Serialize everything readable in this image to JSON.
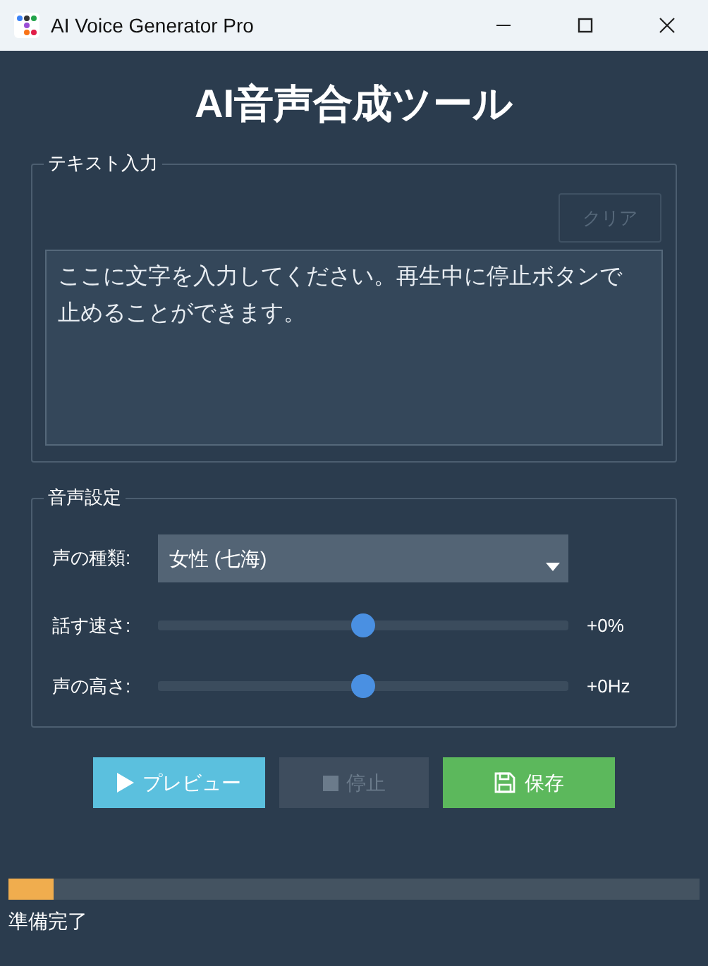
{
  "window": {
    "title": "AI Voice Generator Pro"
  },
  "heading": "AI音声合成ツール",
  "text_input": {
    "legend": "テキスト入力",
    "clear_button": {
      "label": "クリア",
      "disabled": true
    },
    "value": "ここに文字を入力してください。再生中に停止ボタンで止めることができます。"
  },
  "voice_settings": {
    "legend": "音声設定",
    "voice": {
      "label": "声の種類:",
      "value": "女性 (七海)"
    },
    "sliders": [
      {
        "label": "話す速さ:",
        "level": 0.5,
        "reading": "+0%"
      },
      {
        "label": "声の高さ:",
        "level": 0.5,
        "reading": "+0Hz"
      }
    ]
  },
  "buttons": [
    {
      "kind": "play",
      "label": "プレビュー",
      "disabled": false
    },
    {
      "kind": "stop",
      "label": "停止",
      "disabled": true
    },
    {
      "kind": "save",
      "label": "保存",
      "disabled": false
    }
  ],
  "progress": {
    "level": 0.065
  },
  "status_bar": "準備完了"
}
